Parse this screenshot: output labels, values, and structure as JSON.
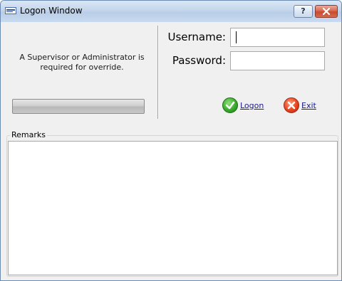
{
  "window": {
    "title": "Logon Window",
    "help_label": "?",
    "close_label": "x"
  },
  "override": {
    "message": "A Supervisor or Administrator is required for override."
  },
  "form": {
    "username_label": "Username:",
    "username_value": "",
    "password_label": "Password:",
    "password_value": ""
  },
  "actions": {
    "logon_label": "Logon",
    "exit_label": "Exit",
    "logon_icon": "green-check-icon",
    "exit_icon": "red-x-icon"
  },
  "remarks": {
    "label": "Remarks",
    "value": ""
  },
  "colors": {
    "titlebar": "#c4d6ec",
    "close_button": "#d9694f",
    "link": "#1a1a8c"
  }
}
